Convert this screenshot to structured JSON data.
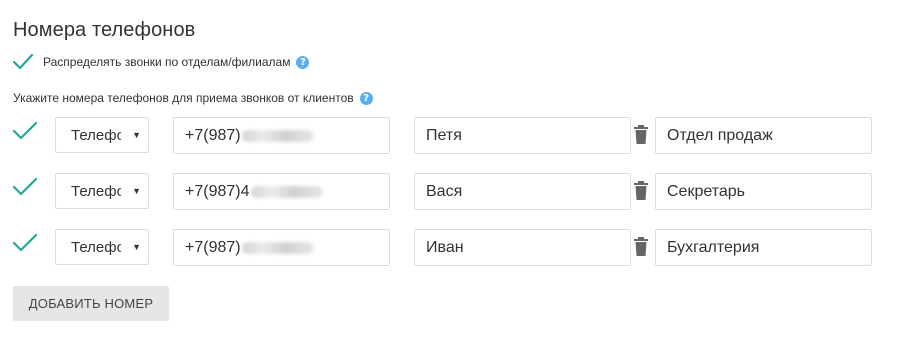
{
  "page": {
    "title": "Номера телефонов"
  },
  "distribute": {
    "checked": true,
    "label": "Распределять звонки по отделам/филиалам",
    "help": "?"
  },
  "hint": {
    "label": "Укажите номера телефонов для приема звонков от клиентов",
    "help": "?"
  },
  "rows": [
    {
      "enabled": true,
      "type": "Телефон",
      "phone_prefix": "+7(987)",
      "phone_hidden": "blurred",
      "name": "Петя",
      "department": "Отдел продаж"
    },
    {
      "enabled": true,
      "type": "Телефон",
      "phone_prefix": "+7(987)4",
      "phone_hidden": "blurred",
      "name": "Вася",
      "department": "Секретарь"
    },
    {
      "enabled": true,
      "type": "Телефон",
      "phone_prefix": "+7(987)",
      "phone_hidden": "blurred",
      "name": "Иван",
      "department": "Бухгалтерия"
    }
  ],
  "add_button": {
    "label": "ДОБАВИТЬ НОМЕР"
  },
  "colors": {
    "check": "#26a69a",
    "help": "#5aaef0",
    "trash": "#666666",
    "button_bg": "#e6e6e6"
  },
  "icons": {
    "check": "check-icon",
    "help": "help-icon",
    "trash": "trash-icon",
    "caret": "caret-down-icon"
  }
}
